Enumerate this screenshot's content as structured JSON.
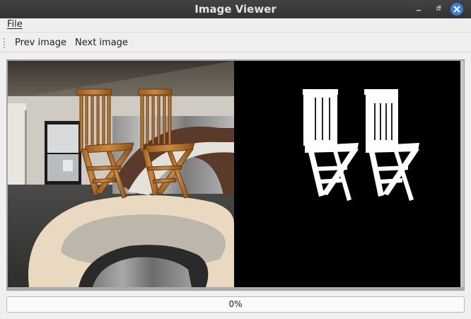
{
  "window": {
    "title": "Image Viewer",
    "minimize_icon": "minimize-icon",
    "restore_icon": "restore-icon",
    "close_icon": "close-icon",
    "accent": "#3a7fd0"
  },
  "menu": {
    "file": "File"
  },
  "toolbar": {
    "prev": "Prev image",
    "next": "Next image"
  },
  "viewer": {
    "left_image": "room photo with two wooden folding chairs",
    "right_image": "binary segmentation mask of two chairs"
  },
  "progress": {
    "value": 0,
    "text": "0%"
  }
}
